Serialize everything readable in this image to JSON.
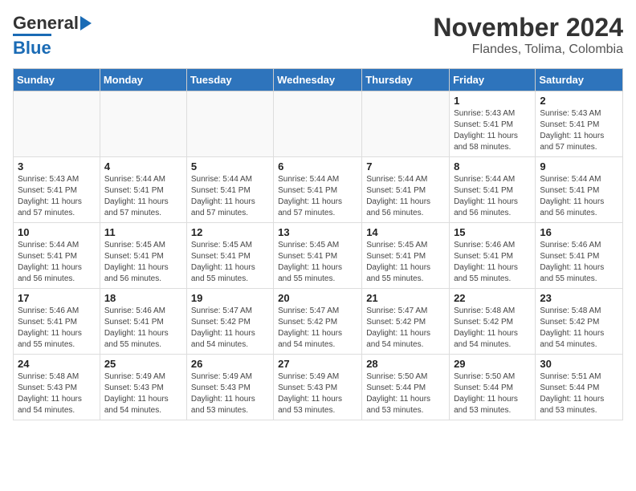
{
  "logo": {
    "line1": "General",
    "line2": "Blue"
  },
  "title": "November 2024",
  "subtitle": "Flandes, Tolima, Colombia",
  "weekdays": [
    "Sunday",
    "Monday",
    "Tuesday",
    "Wednesday",
    "Thursday",
    "Friday",
    "Saturday"
  ],
  "weeks": [
    [
      {
        "day": "",
        "info": ""
      },
      {
        "day": "",
        "info": ""
      },
      {
        "day": "",
        "info": ""
      },
      {
        "day": "",
        "info": ""
      },
      {
        "day": "",
        "info": ""
      },
      {
        "day": "1",
        "info": "Sunrise: 5:43 AM\nSunset: 5:41 PM\nDaylight: 11 hours\nand 58 minutes."
      },
      {
        "day": "2",
        "info": "Sunrise: 5:43 AM\nSunset: 5:41 PM\nDaylight: 11 hours\nand 57 minutes."
      }
    ],
    [
      {
        "day": "3",
        "info": "Sunrise: 5:43 AM\nSunset: 5:41 PM\nDaylight: 11 hours\nand 57 minutes."
      },
      {
        "day": "4",
        "info": "Sunrise: 5:44 AM\nSunset: 5:41 PM\nDaylight: 11 hours\nand 57 minutes."
      },
      {
        "day": "5",
        "info": "Sunrise: 5:44 AM\nSunset: 5:41 PM\nDaylight: 11 hours\nand 57 minutes."
      },
      {
        "day": "6",
        "info": "Sunrise: 5:44 AM\nSunset: 5:41 PM\nDaylight: 11 hours\nand 57 minutes."
      },
      {
        "day": "7",
        "info": "Sunrise: 5:44 AM\nSunset: 5:41 PM\nDaylight: 11 hours\nand 56 minutes."
      },
      {
        "day": "8",
        "info": "Sunrise: 5:44 AM\nSunset: 5:41 PM\nDaylight: 11 hours\nand 56 minutes."
      },
      {
        "day": "9",
        "info": "Sunrise: 5:44 AM\nSunset: 5:41 PM\nDaylight: 11 hours\nand 56 minutes."
      }
    ],
    [
      {
        "day": "10",
        "info": "Sunrise: 5:44 AM\nSunset: 5:41 PM\nDaylight: 11 hours\nand 56 minutes."
      },
      {
        "day": "11",
        "info": "Sunrise: 5:45 AM\nSunset: 5:41 PM\nDaylight: 11 hours\nand 56 minutes."
      },
      {
        "day": "12",
        "info": "Sunrise: 5:45 AM\nSunset: 5:41 PM\nDaylight: 11 hours\nand 55 minutes."
      },
      {
        "day": "13",
        "info": "Sunrise: 5:45 AM\nSunset: 5:41 PM\nDaylight: 11 hours\nand 55 minutes."
      },
      {
        "day": "14",
        "info": "Sunrise: 5:45 AM\nSunset: 5:41 PM\nDaylight: 11 hours\nand 55 minutes."
      },
      {
        "day": "15",
        "info": "Sunrise: 5:46 AM\nSunset: 5:41 PM\nDaylight: 11 hours\nand 55 minutes."
      },
      {
        "day": "16",
        "info": "Sunrise: 5:46 AM\nSunset: 5:41 PM\nDaylight: 11 hours\nand 55 minutes."
      }
    ],
    [
      {
        "day": "17",
        "info": "Sunrise: 5:46 AM\nSunset: 5:41 PM\nDaylight: 11 hours\nand 55 minutes."
      },
      {
        "day": "18",
        "info": "Sunrise: 5:46 AM\nSunset: 5:41 PM\nDaylight: 11 hours\nand 55 minutes."
      },
      {
        "day": "19",
        "info": "Sunrise: 5:47 AM\nSunset: 5:42 PM\nDaylight: 11 hours\nand 54 minutes."
      },
      {
        "day": "20",
        "info": "Sunrise: 5:47 AM\nSunset: 5:42 PM\nDaylight: 11 hours\nand 54 minutes."
      },
      {
        "day": "21",
        "info": "Sunrise: 5:47 AM\nSunset: 5:42 PM\nDaylight: 11 hours\nand 54 minutes."
      },
      {
        "day": "22",
        "info": "Sunrise: 5:48 AM\nSunset: 5:42 PM\nDaylight: 11 hours\nand 54 minutes."
      },
      {
        "day": "23",
        "info": "Sunrise: 5:48 AM\nSunset: 5:42 PM\nDaylight: 11 hours\nand 54 minutes."
      }
    ],
    [
      {
        "day": "24",
        "info": "Sunrise: 5:48 AM\nSunset: 5:43 PM\nDaylight: 11 hours\nand 54 minutes."
      },
      {
        "day": "25",
        "info": "Sunrise: 5:49 AM\nSunset: 5:43 PM\nDaylight: 11 hours\nand 54 minutes."
      },
      {
        "day": "26",
        "info": "Sunrise: 5:49 AM\nSunset: 5:43 PM\nDaylight: 11 hours\nand 53 minutes."
      },
      {
        "day": "27",
        "info": "Sunrise: 5:49 AM\nSunset: 5:43 PM\nDaylight: 11 hours\nand 53 minutes."
      },
      {
        "day": "28",
        "info": "Sunrise: 5:50 AM\nSunset: 5:44 PM\nDaylight: 11 hours\nand 53 minutes."
      },
      {
        "day": "29",
        "info": "Sunrise: 5:50 AM\nSunset: 5:44 PM\nDaylight: 11 hours\nand 53 minutes."
      },
      {
        "day": "30",
        "info": "Sunrise: 5:51 AM\nSunset: 5:44 PM\nDaylight: 11 hours\nand 53 minutes."
      }
    ]
  ]
}
